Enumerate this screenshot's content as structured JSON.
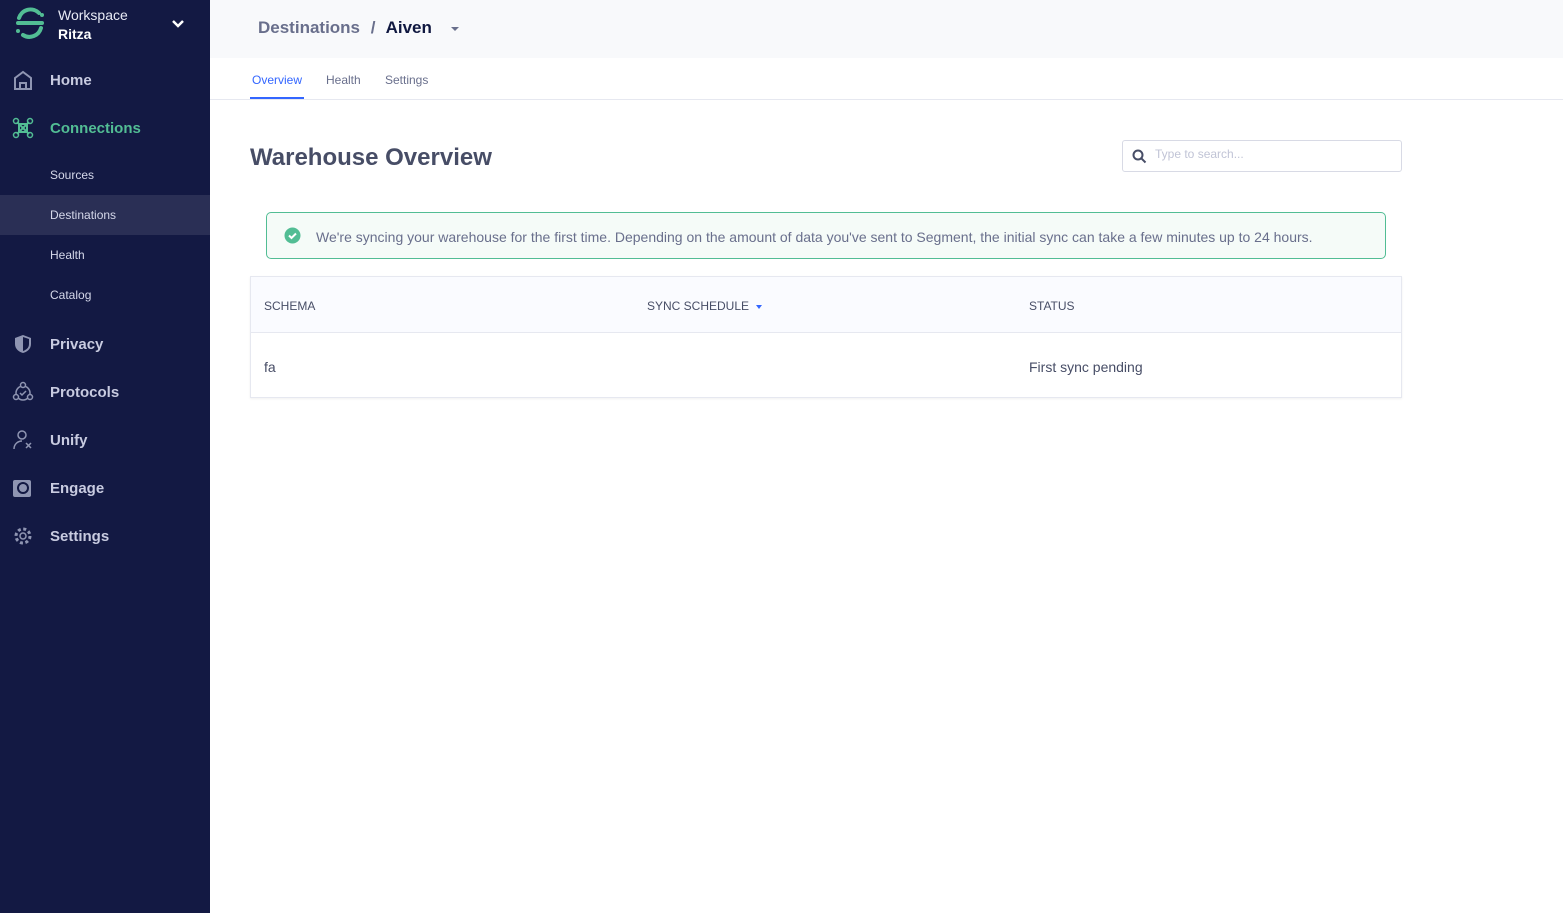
{
  "workspace": {
    "label": "Workspace",
    "name": "Ritza"
  },
  "nav": [
    {
      "label": "Home",
      "icon": "home-icon"
    },
    {
      "label": "Connections",
      "icon": "connections-icon"
    },
    {
      "label": "Privacy",
      "icon": "shield-icon"
    },
    {
      "label": "Protocols",
      "icon": "protocols-icon"
    },
    {
      "label": "Unify",
      "icon": "unify-icon"
    },
    {
      "label": "Engage",
      "icon": "engage-icon"
    },
    {
      "label": "Settings",
      "icon": "gear-icon"
    }
  ],
  "subnav": [
    "Sources",
    "Destinations",
    "Health",
    "Catalog"
  ],
  "breadcrumb": {
    "parent": "Destinations",
    "sep": "/",
    "current": "Aiven"
  },
  "tabs": [
    "Overview",
    "Health",
    "Settings"
  ],
  "title": "Warehouse Overview",
  "search": {
    "placeholder": "Type to search..."
  },
  "alert": "We're syncing your warehouse for the first time. Depending on the amount of data you've sent to Segment, the initial sync can take a few minutes up to 24 hours.",
  "table": {
    "headers": [
      "SCHEMA",
      "SYNC SCHEDULE",
      "STATUS"
    ],
    "rows": [
      [
        "fa",
        "",
        "First sync pending"
      ]
    ]
  },
  "colors": {
    "sidebar": "#131943",
    "accent": "#52bd94",
    "link": "#3366ff"
  }
}
